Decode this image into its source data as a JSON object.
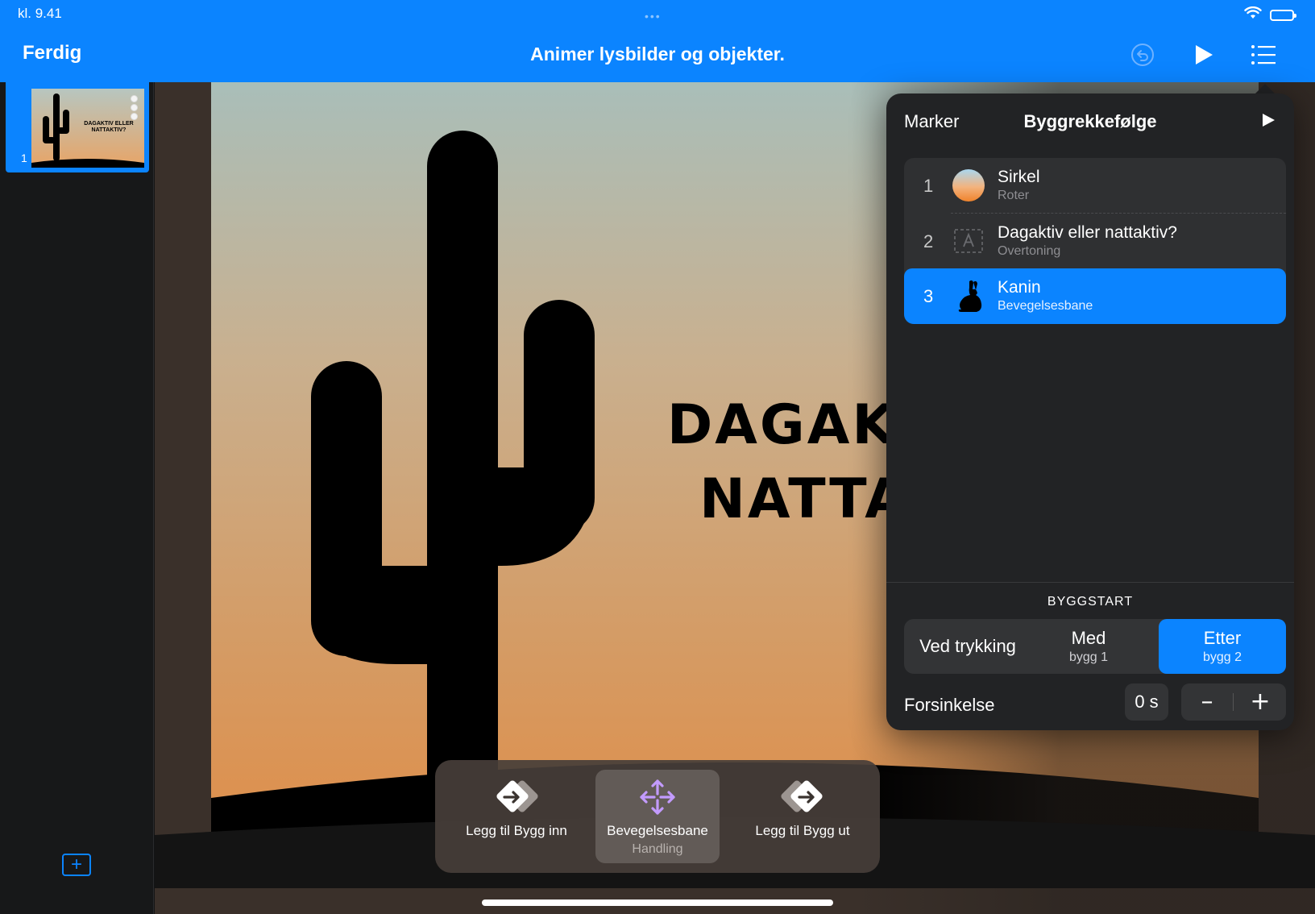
{
  "status": {
    "time": "kl. 9.41",
    "dots": "•••"
  },
  "header": {
    "done_label": "Ferdig",
    "title": "Animer lysbilder og objekter."
  },
  "navigator": {
    "slides": [
      {
        "number": "1",
        "title": "DAGAKTIV ELLER NATTAKTIV?"
      }
    ],
    "add_label": "+"
  },
  "slide": {
    "title_line1": "DAGAK",
    "title_line2": "NATTA"
  },
  "build_order": {
    "select_label": "Marker",
    "title": "Byggrekkefølge",
    "items": [
      {
        "number": "1",
        "name": "Sirkel",
        "effect": "Roter",
        "thumb_icon": "gradient-circle-icon"
      },
      {
        "number": "2",
        "name": "Dagaktiv eller nattaktiv?",
        "effect": "Overtoning",
        "thumb_icon": "text-box-icon"
      },
      {
        "number": "3",
        "name": "Kanin",
        "effect": "Bevegelsesbane",
        "thumb_icon": "rabbit-icon",
        "selected": true
      }
    ],
    "start_section": "BYGGSTART",
    "start_options": [
      {
        "label": "Ved trykking",
        "sub": ""
      },
      {
        "label": "Med",
        "sub": "bygg 1"
      },
      {
        "label": "Etter",
        "sub": "bygg 2",
        "active": true
      }
    ],
    "delay_label": "Forsinkelse",
    "delay_value": "0 s",
    "minus_label": "–",
    "plus_label": "+"
  },
  "toolbar": {
    "build_in_label": "Legg til Bygg inn",
    "motion_label": "Bevegelsesbane",
    "motion_sub": "Handling",
    "build_out_label": "Legg til Bygg ut"
  },
  "colors": {
    "accent": "#0b84ff",
    "panel": "#222325",
    "motion_icon": "#c39bff"
  }
}
